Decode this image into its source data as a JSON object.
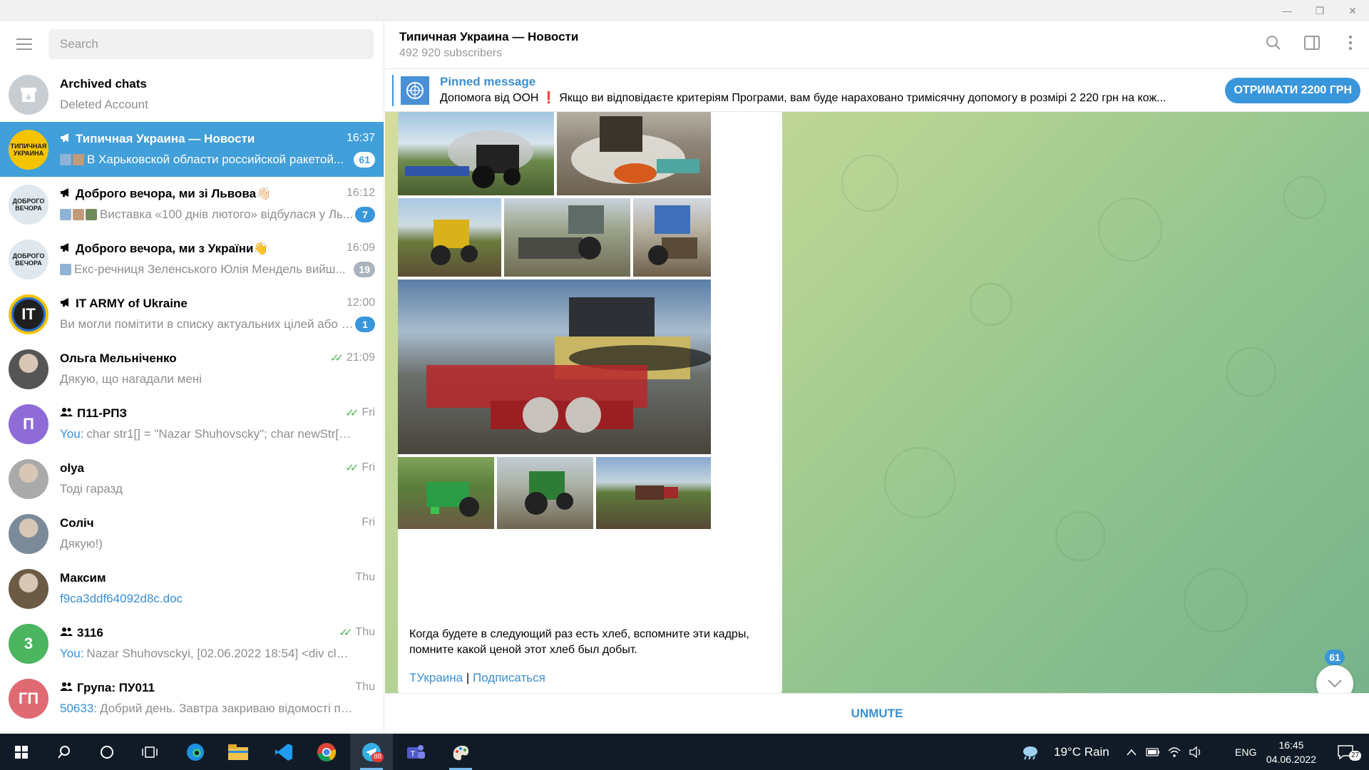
{
  "window": {
    "minimize": "—",
    "restore": "❐",
    "close": "✕"
  },
  "search": {
    "placeholder": "Search"
  },
  "chats": [
    {
      "title": "Archived chats",
      "message": "Deleted Account",
      "time": "",
      "badge": "",
      "avatar_color": "#c8cdd2",
      "avatar_text": "",
      "icon": "archive-icon"
    },
    {
      "title": "Типичная Украина — Новости",
      "message": "В Харьковской области российской ракетой...",
      "time": "16:37",
      "badge": "61",
      "avatar_color": "#f5c400",
      "avatar_text": "ТИПИЧНАЯ УКРАИНА",
      "icon": "channel-icon",
      "active": true
    },
    {
      "title": "Доброго вечора, ми зі Львова👋🏻",
      "message": "Виставка «100 днів лютого» відбулася у Ль...",
      "time": "16:12",
      "badge": "7",
      "avatar_color": "#dfe8ee",
      "avatar_text": "ДОБРОГО ВЕЧОРА",
      "icon": "channel-icon"
    },
    {
      "title": "Доброго вечора, ми з України👋",
      "message": "Екс-речниця Зеленського Юлія Мендель вийш...",
      "time": "16:09",
      "badge": "19",
      "avatar_color": "#dfe8ee",
      "avatar_text": "ДОБРОГО ВЕЧОРА",
      "icon": "channel-icon"
    },
    {
      "title": "IT ARMY of Ukraine",
      "message": "Ви могли помітити в списку актуальних цілей або л...",
      "time": "12:00",
      "badge": "1",
      "avatar_color": "#1f1f1f",
      "avatar_text": "IT",
      "icon": "channel-icon"
    },
    {
      "title": "Ольга Мельніченко",
      "message": "Дякую, що нагадали мені",
      "time": "21:09",
      "badge": "",
      "avatar_color": "#555",
      "avatar_text": "",
      "read": true
    },
    {
      "title": "П11-РПЗ",
      "sender": "You:",
      "message": " char str1[] = \"Nazar Shuhovscky\";   char newStr[100] ...",
      "time": "Fri",
      "badge": "",
      "avatar_color": "#8f6bd8",
      "avatar_text": "П",
      "icon": "group-icon",
      "read": true
    },
    {
      "title": "olya",
      "message": "Тоді гаразд",
      "time": "Fri",
      "badge": "",
      "avatar_color": "#aaa",
      "avatar_text": "",
      "read": true
    },
    {
      "title": "Соліч",
      "message": "Дякую!)",
      "time": "Fri",
      "badge": "",
      "avatar_color": "#7a8a99",
      "avatar_text": ""
    },
    {
      "title": "Максим",
      "message": "f9ca3ddf64092d8c.doc",
      "time": "Thu",
      "badge": "",
      "avatar_color": "#6b5a44",
      "avatar_text": "",
      "link": true
    },
    {
      "title": "3116",
      "sender": "You:",
      "message": " Nazar Shuhovsckyi, [02.06.2022 18:54] <div class=\"co...",
      "time": "Thu",
      "badge": "",
      "avatar_color": "#4cb560",
      "avatar_text": "3",
      "icon": "group-icon",
      "read": true
    },
    {
      "title": "Група: ПУ011",
      "sender": "50633:",
      "message": " Добрий день. Завтра закриваю відомості по кур...",
      "time": "Thu",
      "badge": "",
      "avatar_color": "#e06a74",
      "avatar_text": "ГП",
      "icon": "group-icon"
    }
  ],
  "header": {
    "title": "Типичная Украина — Новости",
    "subtitle": "492 920 subscribers"
  },
  "pinned": {
    "title": "Pinned message",
    "text": "Допомога від ООН ❗️ Якщо ви відповідаєте критеріям Програми, вам буде нараховано тримісячну допомогу в розмірі 2 220 грн на кож...",
    "button": "ОТРИМАТИ 2200 ГРН"
  },
  "post": {
    "text": "Когда будете в следующий раз есть хлеб, вспомните эти кадры, помните какой ценой этот хлеб был добыт.",
    "link1": "ТУкраина",
    "separator": "|",
    "link2": "Подписаться"
  },
  "scroll_badge": "61",
  "composer": {
    "unmute": "UNMUTE"
  },
  "taskbar": {
    "weather": "19°C  Rain",
    "lang": "ENG",
    "time": "16:45",
    "date": "04.06.2022",
    "notifications": "27",
    "telegram_badge": "88"
  }
}
